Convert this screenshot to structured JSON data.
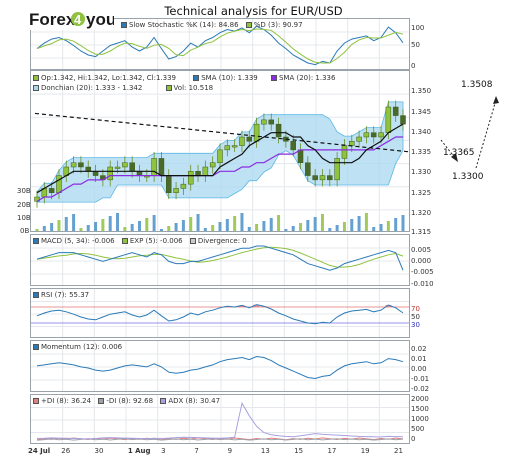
{
  "title": "Technical analysis for EUR/USD",
  "logo_text": "Forex4you",
  "colors": {
    "grid": "#e4e8ec",
    "candle": "#6b8e23",
    "candleBody": "#8fc23d",
    "donchianFill": "#a8d8f0",
    "donchian": "#5bb8e6",
    "sma10": "#111111",
    "sma20": "#8a2be2",
    "volume": "#4a90c8",
    "trend": "#111111",
    "macd": "#2a7ab8",
    "signal": "#8fc23d",
    "rsi": "#2a7ab8",
    "rsiHigh": "#e07070",
    "rsiLow": "#7070e0",
    "momentum": "#2a7ab8",
    "pdi": "#e08080",
    "mdi": "#9aa3ab",
    "adx": "#a8a0e0"
  },
  "stoch": {
    "legend": [
      {
        "label": "Slow Stochastic %K (14): 84.86",
        "color": "#2a7ab8"
      },
      {
        "label": "%D (3): 90.97",
        "color": "#8fc23d"
      }
    ],
    "ticks": [
      "100",
      "50",
      "0"
    ]
  },
  "price": {
    "legend": [
      {
        "label": "Op:1.342, Hi:1.342, Lo:1.342, Cl:1.339",
        "color": "#8fc23d"
      },
      {
        "label": "SMA (10): 1.339",
        "color": "#2a7ab8"
      },
      {
        "label": "SMA (20): 1.336",
        "color": "#8a2be2"
      },
      {
        "label": "Donchian (20): 1.333 - 1.342",
        "color": "#a8d8f0"
      },
      {
        "label": "Vol: 10.518",
        "color": "#8fc23d"
      }
    ],
    "ticks": [
      "1.350",
      "1.345",
      "1.340",
      "1.335",
      "1.330",
      "1.325",
      "1.320",
      "1.315"
    ],
    "vol_ticks": [
      "30B",
      "20B",
      "10B",
      "0B"
    ]
  },
  "macd": {
    "legend": [
      {
        "label": "MACD (5, 34): -0.006",
        "color": "#2a7ab8"
      },
      {
        "label": "EXP (5): -0.006",
        "color": "#8fc23d"
      },
      {
        "label": "Divergence: 0",
        "color": "#cccccc"
      }
    ],
    "ticks": [
      "0.005",
      "0.000",
      "-0.005",
      "-0.010"
    ]
  },
  "rsi": {
    "legend": [
      {
        "label": "RSI (7): 55.37",
        "color": "#2a7ab8"
      }
    ],
    "ticks": [
      "70",
      "50",
      "30"
    ]
  },
  "momentum": {
    "legend": [
      {
        "label": "Momentum (12): 0.006",
        "color": "#2a7ab8"
      }
    ],
    "ticks": [
      "0.02",
      "0.01",
      "0.00",
      "-0.01",
      "-0.02"
    ]
  },
  "adx": {
    "legend": [
      {
        "label": "+DI (8): 36.24",
        "color": "#e08080"
      },
      {
        "label": "-DI (8): 92.68",
        "color": "#9aa3ab"
      },
      {
        "label": "ADX (8): 30.47",
        "color": "#a8a0e0"
      }
    ],
    "ticks": [
      "2000",
      "1500",
      "1000",
      "500",
      "0"
    ]
  },
  "annotations": {
    "a": "1.3508",
    "b": "1.3365",
    "c": "1.3300"
  },
  "x_labels": [
    {
      "t": "24 Jul",
      "bold": true
    },
    {
      "t": "26",
      "bold": false
    },
    {
      "t": "30",
      "bold": false
    },
    {
      "t": "1 Aug",
      "bold": true
    },
    {
      "t": "3",
      "bold": false
    },
    {
      "t": "7",
      "bold": false
    },
    {
      "t": "9",
      "bold": false
    },
    {
      "t": "13",
      "bold": false
    },
    {
      "t": "15",
      "bold": false
    },
    {
      "t": "17",
      "bold": false
    },
    {
      "t": "19",
      "bold": false
    },
    {
      "t": "21",
      "bold": false
    }
  ],
  "chart_data": {
    "type": "line",
    "title": "Technical analysis for EUR/USD",
    "candles_close": [
      1.322,
      1.324,
      1.323,
      1.327,
      1.329,
      1.33,
      1.329,
      1.328,
      1.327,
      1.326,
      1.329,
      1.329,
      1.33,
      1.328,
      1.327,
      1.327,
      1.331,
      1.327,
      1.323,
      1.324,
      1.325,
      1.328,
      1.327,
      1.329,
      1.33,
      1.333,
      1.334,
      1.334,
      1.336,
      1.335,
      1.339,
      1.34,
      1.339,
      1.336,
      1.335,
      1.333,
      1.33,
      1.327,
      1.326,
      1.327,
      1.326,
      1.331,
      1.334,
      1.335,
      1.336,
      1.337,
      1.336,
      1.337,
      1.343,
      1.341,
      1.339
    ],
    "price_ylim": [
      1.315,
      1.35
    ],
    "sma10": [
      1.323,
      1.324,
      1.325,
      1.326,
      1.327,
      1.328,
      1.328,
      1.328,
      1.328,
      1.328,
      1.328,
      1.328,
      1.328,
      1.328,
      1.328,
      1.328,
      1.328,
      1.327,
      1.327,
      1.327,
      1.327,
      1.327,
      1.327,
      1.327,
      1.327,
      1.329,
      1.33,
      1.331,
      1.332,
      1.334,
      1.335,
      1.336,
      1.337,
      1.337,
      1.337,
      1.336,
      1.336,
      1.334,
      1.333,
      1.331,
      1.33,
      1.33,
      1.33,
      1.33,
      1.331,
      1.333,
      1.334,
      1.335,
      1.337,
      1.338,
      1.339
    ],
    "sma20": [
      1.321,
      1.322,
      1.322,
      1.323,
      1.324,
      1.325,
      1.325,
      1.326,
      1.326,
      1.326,
      1.327,
      1.327,
      1.327,
      1.327,
      1.327,
      1.327,
      1.327,
      1.327,
      1.327,
      1.327,
      1.327,
      1.327,
      1.327,
      1.327,
      1.327,
      1.328,
      1.328,
      1.328,
      1.329,
      1.329,
      1.33,
      1.33,
      1.331,
      1.332,
      1.332,
      1.332,
      1.333,
      1.333,
      1.333,
      1.333,
      1.333,
      1.333,
      1.333,
      1.333,
      1.333,
      1.333,
      1.333,
      1.334,
      1.335,
      1.336,
      1.336
    ],
    "macd": [
      -0.001,
      0.0,
      0.001,
      0.002,
      0.002,
      0.002,
      0.001,
      0.0,
      -0.001,
      -0.002,
      -0.001,
      0.0,
      0.001,
      0.002,
      0.001,
      0.0,
      0.002,
      0.001,
      -0.002,
      -0.003,
      -0.003,
      -0.002,
      -0.002,
      -0.001,
      0.0,
      0.001,
      0.002,
      0.003,
      0.004,
      0.004,
      0.005,
      0.005,
      0.004,
      0.003,
      0.002,
      0.001,
      -0.001,
      -0.003,
      -0.004,
      -0.005,
      -0.006,
      -0.005,
      -0.003,
      -0.002,
      -0.001,
      0.0,
      0.001,
      0.002,
      0.003,
      0.002,
      -0.006
    ],
    "rsi": [
      48,
      55,
      60,
      62,
      58,
      52,
      45,
      40,
      38,
      45,
      52,
      55,
      58,
      50,
      45,
      50,
      62,
      48,
      35,
      38,
      45,
      55,
      50,
      58,
      62,
      68,
      72,
      70,
      74,
      68,
      76,
      72,
      65,
      55,
      48,
      40,
      35,
      30,
      28,
      32,
      30,
      45,
      55,
      60,
      62,
      64,
      58,
      62,
      75,
      68,
      55.37
    ],
    "momentum": [
      0.002,
      0.003,
      0.004,
      0.005,
      0.004,
      0.003,
      0.001,
      0.0,
      -0.002,
      -0.003,
      -0.002,
      0.0,
      0.002,
      0.003,
      0.002,
      0.001,
      0.004,
      0.001,
      -0.004,
      -0.005,
      -0.004,
      -0.002,
      -0.001,
      0.001,
      0.003,
      0.006,
      0.008,
      0.009,
      0.01,
      0.008,
      0.011,
      0.01,
      0.007,
      0.003,
      0.0,
      -0.003,
      -0.006,
      -0.009,
      -0.01,
      -0.008,
      -0.007,
      -0.002,
      0.002,
      0.004,
      0.005,
      0.006,
      0.004,
      0.005,
      0.009,
      0.008,
      0.006
    ],
    "adx": [
      120,
      130,
      150,
      140,
      130,
      120,
      110,
      100,
      120,
      150,
      160,
      150,
      140,
      130,
      120,
      110,
      130,
      120,
      140,
      160,
      180,
      170,
      160,
      150,
      140,
      130,
      150,
      180,
      1800,
      1200,
      700,
      400,
      300,
      250,
      220,
      200,
      250,
      300,
      350,
      320,
      300,
      280,
      260,
      240,
      220,
      210,
      200,
      190,
      220,
      210,
      200
    ]
  }
}
